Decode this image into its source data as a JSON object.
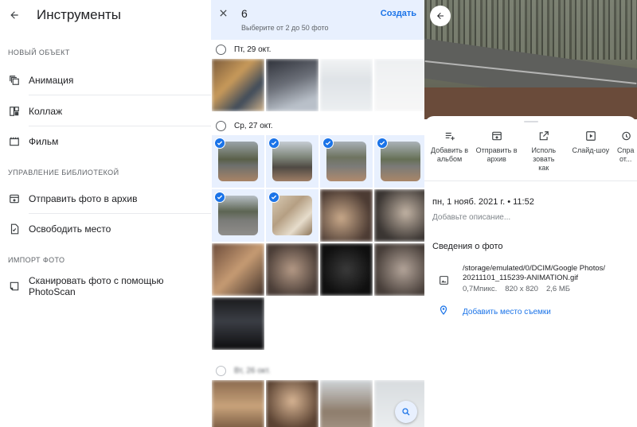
{
  "left": {
    "title": "Инструменты",
    "sections": [
      {
        "header": "НОВЫЙ ОБЪЕКТ",
        "items": [
          {
            "label": "Анимация",
            "icon": "animation-icon"
          },
          {
            "label": "Коллаж",
            "icon": "collage-icon"
          },
          {
            "label": "Фильм",
            "icon": "movie-icon"
          }
        ]
      },
      {
        "header": "УПРАВЛЕНИЕ БИБЛИОТЕКОЙ",
        "items": [
          {
            "label": "Отправить фото в архив",
            "icon": "archive-icon"
          },
          {
            "label": "Освободить место",
            "icon": "free-space-icon"
          }
        ]
      },
      {
        "header": "ИМПОРТ ФОТО",
        "items": [
          {
            "label": "Сканировать фото с помощью PhotoScan",
            "icon": "photoscan-icon"
          }
        ]
      }
    ]
  },
  "middle": {
    "count": "6",
    "hint": "Выберите от 2 до 50 фото",
    "create_label": "Создать",
    "groups": [
      {
        "date": "Пт, 29 окт.",
        "selected_count": 0
      },
      {
        "date": "Ср, 27 окт.",
        "selected_count": 6
      },
      {
        "date": "Вт, 26 окт.",
        "selected_count": 0
      }
    ]
  },
  "right": {
    "actions": [
      {
        "label": "Добавить в альбом",
        "icon": "playlist-add-icon"
      },
      {
        "label": "Отправить в архив",
        "icon": "archive-icon"
      },
      {
        "label": "Исполь зовать как",
        "icon": "open-external-icon"
      },
      {
        "label": "Слайд-шоу",
        "icon": "slideshow-icon"
      },
      {
        "label": "Спра от...",
        "icon": "history-icon"
      }
    ],
    "date_time": "пн, 1 нояб. 2021 г. • 11:52",
    "description_placeholder": "Добавьте описание...",
    "details_title": "Сведения о фото",
    "file_path": "/storage/emulated/0/DCIM/Google Photos/ 20211101_115239-ANIMATION.gif",
    "megapixels": "0,7Мпикс.",
    "resolution": "820 x 820",
    "file_size": "2,6 МБ",
    "add_location": "Добавить место съемки"
  },
  "colors": {
    "accent": "#1a73e8",
    "selection_bg": "#e8f0fe"
  }
}
